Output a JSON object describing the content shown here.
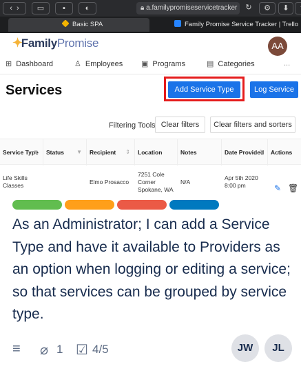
{
  "browser": {
    "url": "a.familypromiseservicetracker",
    "tabs": [
      {
        "title": "Basic SPA",
        "icon": "diamond-icon",
        "color": "#f4b400"
      },
      {
        "title": "Family Promise Service Tracker | Trello",
        "icon": "trello-icon",
        "color": "#2684ff"
      }
    ]
  },
  "app": {
    "logo_family": "Family",
    "logo_promise": "Promise",
    "avatar": "AA",
    "nav": [
      "Dashboard",
      "Employees",
      "Programs",
      "Categories",
      "..."
    ],
    "page_title": "Services",
    "add_service_type": "Add Service Type",
    "log_service": "Log Service",
    "filtering_label": "Filtering Tools:",
    "clear_filters": "Clear filters",
    "clear_filters_sorters": "Clear filters and sorters",
    "table": {
      "headers": [
        "Service Type",
        "Status",
        "Recipient",
        "Location",
        "Notes",
        "Date Provided",
        "Actions"
      ],
      "row": [
        "Life Skills Classes",
        "",
        "Elmo Prosacco",
        "7251 Cole Corner Spokane, WA",
        "N/A",
        "Apr 5th 2020 8:00 pm",
        ""
      ]
    }
  },
  "card": {
    "label_colors": [
      "#61bd4f",
      "#ff9f1a",
      "#eb5a46",
      "#0079bf"
    ],
    "description": "As an Administrator; I can add a Service Type and have it available to Providers as an option when logging or editing a service; so that services can be grouped by service type.",
    "attachments": "1",
    "checklist": "4/5",
    "members": [
      "JW",
      "JL"
    ]
  }
}
